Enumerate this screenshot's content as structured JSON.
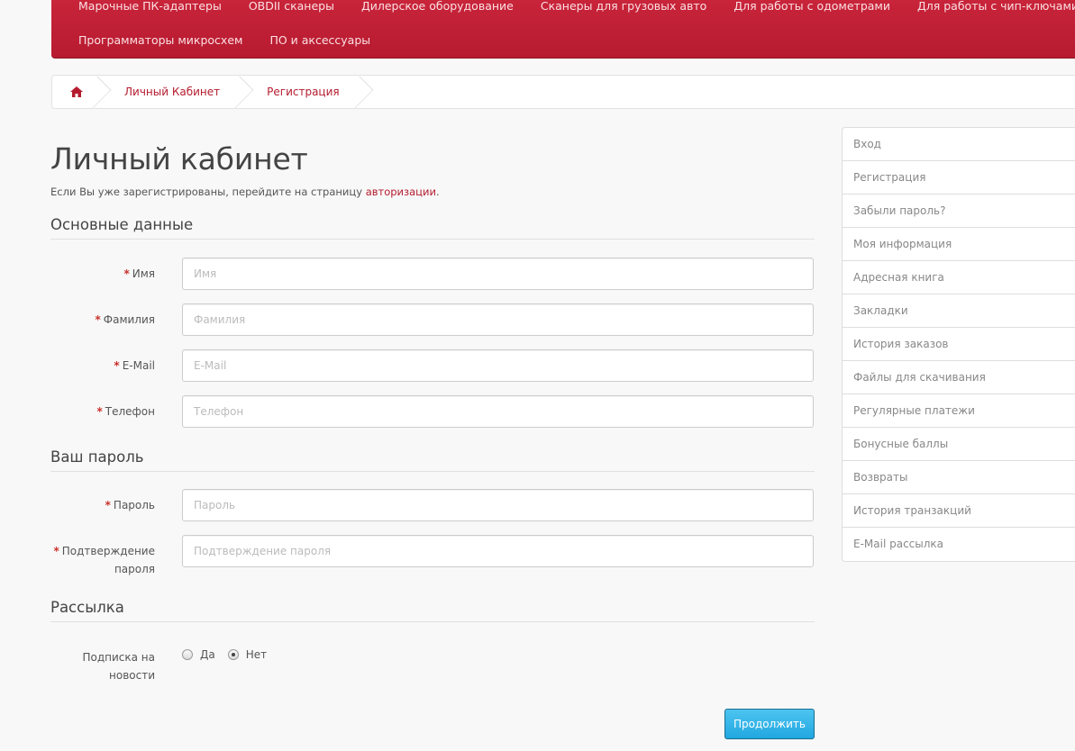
{
  "nav": {
    "row1": [
      "Марочные ПК-адаптеры",
      "OBDII сканеры",
      "Дилерское оборудование",
      "Сканеры для грузовых авто",
      "Для работы с одометрами",
      "Для работы с чип-ключами"
    ],
    "row2": [
      "Программаторы микросхем",
      "ПО и аксессуары"
    ]
  },
  "breadcrumb": {
    "home_icon": "home-icon",
    "items": [
      "Личный Кабинет",
      "Регистрация"
    ]
  },
  "main": {
    "title": "Личный кабинет",
    "intro_text": "Если Вы уже зарегистрированы, перейдите на страницу ",
    "intro_link": "авторизации",
    "intro_end": ".",
    "sections": {
      "personal": "Основные данные",
      "password": "Ваш пароль",
      "newsletter": "Рассылка"
    },
    "fields": {
      "firstname": {
        "label": "Имя",
        "placeholder": "Имя"
      },
      "lastname": {
        "label": "Фамилия",
        "placeholder": "Фамилия"
      },
      "email": {
        "label": "E-Mail",
        "placeholder": "E-Mail"
      },
      "telephone": {
        "label": "Телефон",
        "placeholder": "Телефон"
      },
      "password": {
        "label": "Пароль",
        "placeholder": "Пароль"
      },
      "confirm": {
        "label": "Подтверждение пароля",
        "placeholder": "Подтверждение пароля"
      }
    },
    "required_mark": "*",
    "subscribe": {
      "label": "Подписка на новости",
      "yes": "Да",
      "no": "Нет",
      "selected": "Нет"
    },
    "continue_label": "Продолжить"
  },
  "sidebar": {
    "items": [
      "Вход",
      "Регистрация",
      "Забыли пароль?",
      "Моя информация",
      "Адресная книга",
      "Закладки",
      "История заказов",
      "Файлы для скачивания",
      "Регулярные платежи",
      "Бонусные баллы",
      "Возвраты",
      "История транзакций",
      "E-Mail рассылка"
    ]
  },
  "colors": {
    "brand": "#b71b30",
    "link": "#b41c2e",
    "button": "#21a7e0"
  }
}
